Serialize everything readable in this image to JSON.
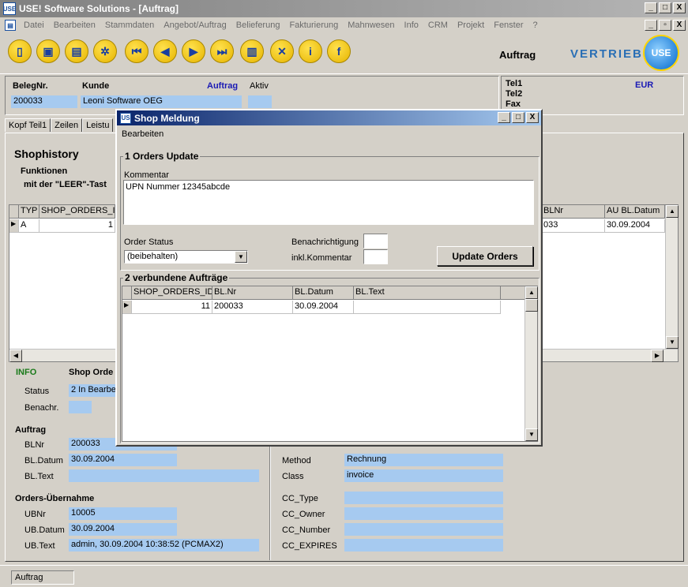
{
  "window": {
    "title": "USE! Software Solutions - [Auftrag]",
    "btn_min": "_",
    "btn_max": "□",
    "btn_close": "X",
    "btn_restore": "▫"
  },
  "menu": [
    "Datei",
    "Bearbeiten",
    "Stammdaten",
    "Angebot/Auftrag",
    "Belieferung",
    "Fakturierung",
    "Mahnwesen",
    "Info",
    "CRM",
    "Projekt",
    "Fenster",
    "?"
  ],
  "toolbar": {
    "buttons": [
      {
        "name": "new-icon",
        "glyph": "▯"
      },
      {
        "name": "save-icon",
        "glyph": "▣"
      },
      {
        "name": "print-icon",
        "glyph": "▤"
      },
      {
        "name": "shower-icon",
        "glyph": "✲"
      },
      {
        "name": "first-record-icon",
        "glyph": "⏮"
      },
      {
        "name": "prev-record-icon",
        "glyph": "◀"
      },
      {
        "name": "next-record-icon",
        "glyph": "▶"
      },
      {
        "name": "last-record-icon",
        "glyph": "⏭"
      },
      {
        "name": "trash-icon",
        "glyph": "▥"
      },
      {
        "name": "cancel-icon",
        "glyph": "✕"
      },
      {
        "name": "info-icon",
        "glyph": "i"
      },
      {
        "name": "function-icon",
        "glyph": "f"
      }
    ],
    "title": "Auftrag",
    "brand": "VERTRIEB",
    "logo": "USE"
  },
  "header": {
    "beleg_label": "BelegNr.",
    "kunde_label": "Kunde",
    "auftrag_label": "Auftrag",
    "aktiv_label": "Aktiv",
    "beleg_value": "200033",
    "kunde_value": "Leoni Software OEG",
    "tel1": "Tel1",
    "tel2": "Tel2",
    "fax": "Fax",
    "currency": "EUR"
  },
  "tabs": [
    "Kopf Teil1",
    "Zeilen",
    "Leistu"
  ],
  "shophistory": {
    "title": "Shophistory",
    "funktionen": "Funktionen",
    "leer_hint": "mit der \"LEER\"-Tast",
    "columns": [
      "TYP",
      "SHOP_ORDERS_I",
      "BLNr",
      "AU BL.Datum"
    ],
    "row": {
      "typ": "A",
      "id": "1",
      "blnr": "033",
      "datum": "30.09.2004"
    }
  },
  "info": {
    "info_label": "INFO",
    "shop_order_label": "Shop Orde",
    "status_label": "Status",
    "status_value": "2  In Bearbe",
    "benachr_label": "Benachr.",
    "benachr_value": ""
  },
  "auftrag": {
    "title": "Auftrag",
    "blnr_label": "BLNr",
    "blnr_value": "200033",
    "bldatum_label": "BL.Datum",
    "bldatum_value": "30.09.2004",
    "bltext_label": "BL.Text",
    "bltext_value": ""
  },
  "orders": {
    "title": "Orders-Übernahme",
    "ubnr_label": "UBNr",
    "ubnr_value": "10005",
    "ubdatum_label": "UB.Datum",
    "ubdatum_value": "30.09.2004",
    "ubtext_label": "UB.Text",
    "ubtext_value": "admin, 30.09.2004 10:38:52 (PCMAX2)"
  },
  "payment": {
    "method_label": "Method",
    "method_value": "Rechnung",
    "class_label": "Class",
    "class_value": "invoice",
    "cctype_label": "CC_Type",
    "cctype_value": "",
    "ccowner_label": "CC_Owner",
    "ccowner_value": "",
    "ccnumber_label": "CC_Number",
    "ccnumber_value": "",
    "ccexpires_label": "CC_EXPIRES",
    "ccexpires_value": ""
  },
  "dialog": {
    "title": "Shop Meldung",
    "menu": "Bearbeiten",
    "group1_title": "1 Orders Update",
    "kommentar_label": "Kommentar",
    "kommentar_value": "UPN Nummer 12345abcde",
    "order_status_label": "Order Status",
    "order_status_value": "(beibehalten)",
    "benachrichtigung_label": "Benachrichtigung",
    "inkl_kommentar_label": "inkl.Kommentar",
    "update_button": "Update Orders",
    "group2_title": "2 verbundene Aufträge",
    "columns": [
      "SHOP_ORDERS_ID",
      "BL.Nr",
      "BL.Datum",
      "BL.Text"
    ],
    "row": {
      "id": "11",
      "blnr": "200033",
      "datum": "30.09.2004",
      "text": ""
    }
  },
  "statusbar": {
    "text": "Auftrag"
  }
}
